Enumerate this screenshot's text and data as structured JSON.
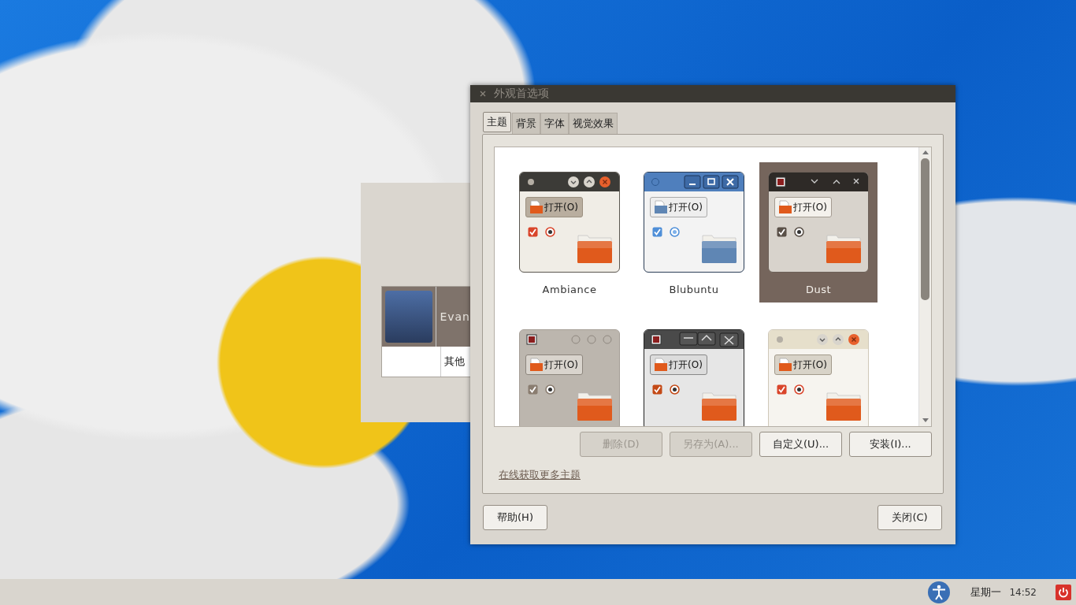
{
  "background_window": {
    "users": [
      {
        "name": "Evan",
        "selected": true
      },
      {
        "name": "其他",
        "selected": false
      }
    ]
  },
  "dialog": {
    "title": "外观首选项",
    "tabs": [
      {
        "label": "主题",
        "selected": true
      },
      {
        "label": "背景",
        "selected": false
      },
      {
        "label": "字体",
        "selected": false
      },
      {
        "label": "视觉效果",
        "selected": false
      }
    ],
    "themes": [
      {
        "name": "Ambiance",
        "kind": "ambiance",
        "open_label": "打开(O)",
        "selected": false
      },
      {
        "name": "Blubuntu",
        "kind": "blubuntu",
        "open_label": "打开(O)",
        "selected": false
      },
      {
        "name": "Dust",
        "kind": "dust",
        "open_label": "打开(O)",
        "selected": true
      },
      {
        "kind": "grey",
        "open_label": "打开(O)",
        "selected": false
      },
      {
        "kind": "dark",
        "open_label": "打开(O)",
        "selected": false
      },
      {
        "kind": "light",
        "open_label": "打开(O)",
        "selected": false
      }
    ],
    "theme_buttons": [
      {
        "label": "删除(D)",
        "disabled": true
      },
      {
        "label": "另存为(A)...",
        "disabled": true
      },
      {
        "label": "自定义(U)...",
        "disabled": false
      },
      {
        "label": "安装(I)...",
        "disabled": false
      }
    ],
    "link": "在线获取更多主题",
    "footer_buttons": [
      {
        "label": "帮助(H)"
      },
      {
        "label": "关闭(C)"
      }
    ]
  },
  "taskbar": {
    "day": "星期一",
    "time": "14:52"
  }
}
